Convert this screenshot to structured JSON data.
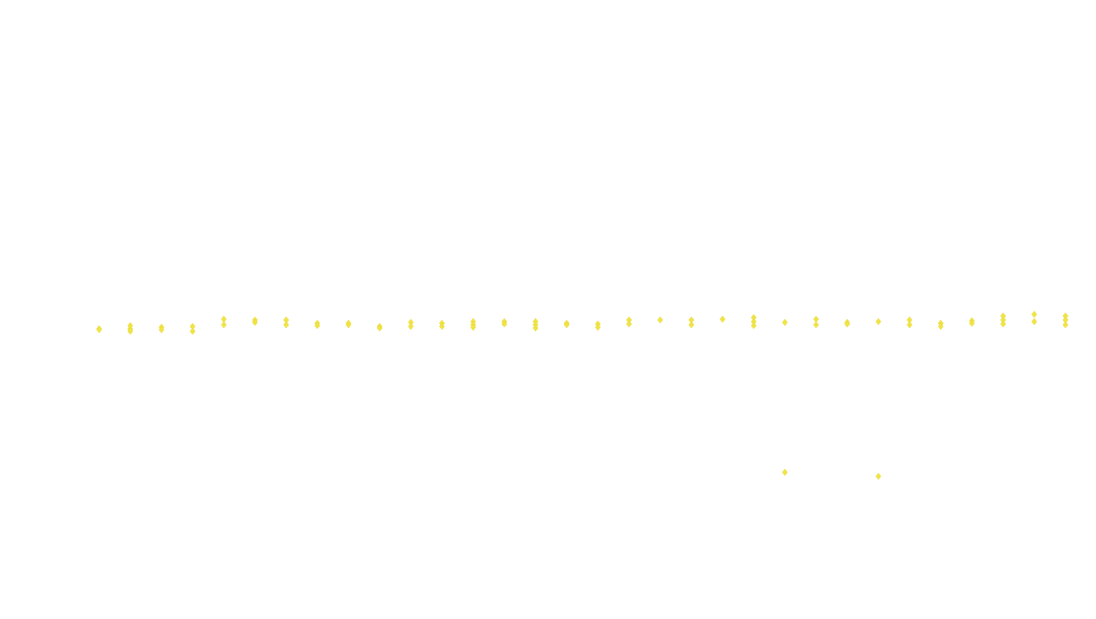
{
  "chart_data": {
    "type": "scatter",
    "title": "",
    "xlabel": "",
    "ylabel": "",
    "grid": false,
    "legend": "none",
    "marker": "diamond",
    "marker_color": "#f0e442",
    "xlim": [
      0,
      32
    ],
    "ylim": [
      -16.8,
      60
    ],
    "x": [
      1,
      2,
      3,
      4,
      5,
      6,
      7,
      8,
      9,
      10,
      11,
      12,
      13,
      14,
      15,
      16,
      17,
      18,
      19,
      20,
      21,
      22,
      23,
      24,
      25,
      26,
      27,
      28,
      29,
      30,
      31,
      32
    ],
    "points": [
      {
        "x": 1,
        "y": [
          19.2,
          19.1
        ]
      },
      {
        "x": 2,
        "y": [
          19.6,
          19.2,
          18.9
        ]
      },
      {
        "x": 3,
        "y": [
          19.4,
          19.1
        ]
      },
      {
        "x": 4,
        "y": [
          19.5,
          18.9
        ]
      },
      {
        "x": 5,
        "y": [
          20.4,
          19.7
        ]
      },
      {
        "x": 6,
        "y": [
          20.3,
          20.0
        ]
      },
      {
        "x": 7,
        "y": [
          20.3,
          19.7
        ]
      },
      {
        "x": 8,
        "y": [
          19.9,
          19.6
        ]
      },
      {
        "x": 9,
        "y": [
          19.9,
          19.7
        ]
      },
      {
        "x": 10,
        "y": [
          19.5,
          19.3
        ]
      },
      {
        "x": 11,
        "y": [
          20.0,
          19.5
        ]
      },
      {
        "x": 12,
        "y": [
          19.9,
          19.5
        ]
      },
      {
        "x": 13,
        "y": [
          20.1,
          19.7,
          19.4
        ]
      },
      {
        "x": 14,
        "y": [
          20.1,
          19.8
        ]
      },
      {
        "x": 15,
        "y": [
          20.1,
          19.7,
          19.3
        ]
      },
      {
        "x": 16,
        "y": [
          19.9,
          19.7
        ]
      },
      {
        "x": 17,
        "y": [
          19.8,
          19.4
        ]
      },
      {
        "x": 18,
        "y": [
          20.3,
          19.8
        ]
      },
      {
        "x": 19,
        "y": [
          20.3
        ]
      },
      {
        "x": 20,
        "y": [
          20.3,
          19.7
        ]
      },
      {
        "x": 21,
        "y": [
          20.4
        ]
      },
      {
        "x": 22,
        "y": [
          20.6,
          20.1,
          19.6
        ]
      },
      {
        "x": 23,
        "y": [
          20.0,
          1.4
        ]
      },
      {
        "x": 24,
        "y": [
          20.4,
          19.7
        ]
      },
      {
        "x": 25,
        "y": [
          20.0,
          19.8
        ]
      },
      {
        "x": 26,
        "y": [
          20.1,
          0.9
        ]
      },
      {
        "x": 27,
        "y": [
          20.3,
          19.7
        ]
      },
      {
        "x": 28,
        "y": [
          19.9,
          19.5
        ]
      },
      {
        "x": 29,
        "y": [
          20.2,
          19.9
        ]
      },
      {
        "x": 30,
        "y": [
          20.8,
          20.3,
          19.8
        ]
      },
      {
        "x": 31,
        "y": [
          21.0,
          20.1
        ]
      },
      {
        "x": 32,
        "y": [
          20.8,
          20.3,
          19.7
        ]
      }
    ]
  }
}
